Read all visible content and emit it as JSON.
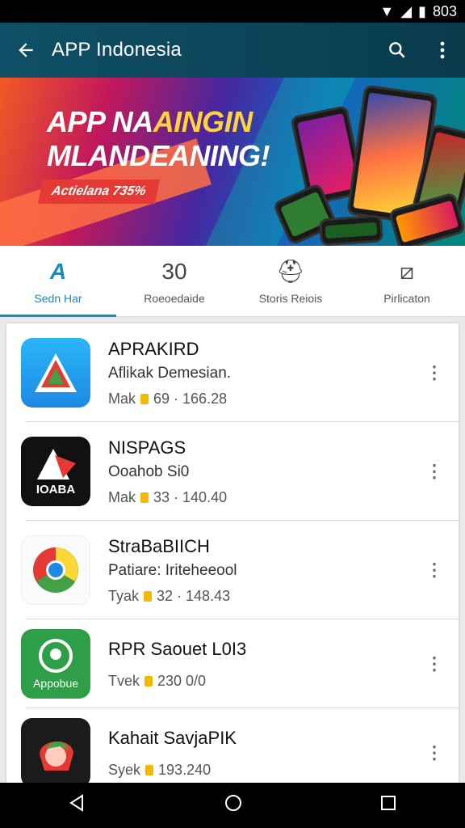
{
  "status_bar": {
    "time": "803",
    "icons": [
      "wifi-icon",
      "signal-icon",
      "battery-icon"
    ]
  },
  "appbar": {
    "title": "APP Indonesia",
    "back_icon": "arrow-left-icon",
    "actions": [
      "search-icon",
      "more-vert-icon"
    ]
  },
  "banner": {
    "line1_a": "APP NA",
    "line1_b": "AINGIN",
    "line2": "MLANDEANING!",
    "pill": "Actielana 735%"
  },
  "tabs": [
    {
      "label": "Sedn Har",
      "icon": "A",
      "active": true
    },
    {
      "label": "Roeoedaide",
      "icon": "30",
      "active": false
    },
    {
      "label": "Storis Reiois",
      "icon": "⛑",
      "active": false
    },
    {
      "label": "Pirlicaton",
      "icon": "⧄",
      "active": false
    }
  ],
  "apps": [
    {
      "name": "APRAKIRD",
      "subtitle": "Aflikak Demesian.",
      "meta_prefix": "Mak",
      "meta_value": "69 · 166.28"
    },
    {
      "name": "NISPAGS",
      "subtitle": "Ooahob Si0",
      "meta_prefix": "Mak",
      "meta_value": "33 · 140.40",
      "icon_text": "IOABA"
    },
    {
      "name": "StraBaBIICH",
      "subtitle": "Patiare: Iriteheeool",
      "meta_prefix": "Tyak",
      "meta_value": "32 · 148.43"
    },
    {
      "name": "RPR Saouet L0I3",
      "subtitle": "",
      "meta_prefix": "Tvek",
      "meta_value": "230 0/0",
      "icon_text": "Appobue"
    },
    {
      "name": "Kahait SavjaPIK",
      "subtitle": "",
      "meta_prefix": "Syek",
      "meta_value": "193.240"
    }
  ],
  "colors": {
    "appbar": "#0f4f66",
    "accent": "#138dbd",
    "coin": "#f5b800"
  },
  "navbar": [
    "back-triangle-icon",
    "home-circle-icon",
    "recents-square-icon"
  ]
}
